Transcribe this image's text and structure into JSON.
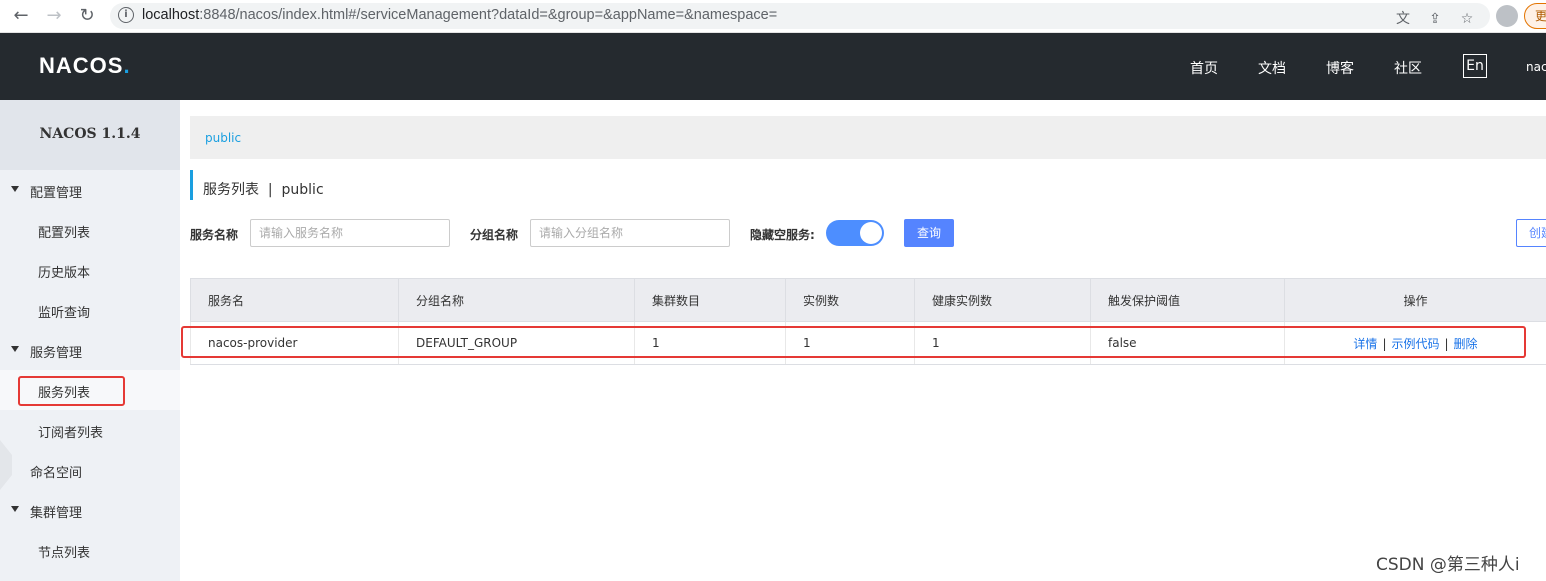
{
  "browser": {
    "url_host": "localhost",
    "url_path": ":8848/nacos/index.html#/serviceManagement?dataId=&group=&appName=&namespace=",
    "update_label": "更"
  },
  "header": {
    "logo_main": "NACOS",
    "logo_dot": ".",
    "nav": [
      "首页",
      "文档",
      "博客",
      "社区"
    ],
    "lang": "En",
    "user": "nac"
  },
  "sidebar": {
    "title": "NACOS 1.1.4",
    "items": [
      {
        "label": "配置管理",
        "type": "group"
      },
      {
        "label": "配置列表",
        "type": "sub"
      },
      {
        "label": "历史版本",
        "type": "sub"
      },
      {
        "label": "监听查询",
        "type": "sub"
      },
      {
        "label": "服务管理",
        "type": "group"
      },
      {
        "label": "服务列表",
        "type": "sub",
        "active": true
      },
      {
        "label": "订阅者列表",
        "type": "sub"
      },
      {
        "label": "命名空间",
        "type": "plain"
      },
      {
        "label": "集群管理",
        "type": "group"
      },
      {
        "label": "节点列表",
        "type": "sub"
      }
    ]
  },
  "main": {
    "breadcrumb": "public",
    "page_title": "服务列表  |  public",
    "filters": {
      "service_name_label": "服务名称",
      "service_name_placeholder": "请输入服务名称",
      "group_name_label": "分组名称",
      "group_name_placeholder": "请输入分组名称",
      "hide_empty_label": "隐藏空服务:",
      "hide_empty_on": true,
      "query_label": "查询",
      "create_label": "创建服务"
    },
    "table": {
      "columns": [
        "服务名",
        "分组名称",
        "集群数目",
        "实例数",
        "健康实例数",
        "触发保护阈值",
        "操作"
      ],
      "rows": [
        [
          "nacos-provider",
          "DEFAULT_GROUP",
          "1",
          "1",
          "1",
          "false"
        ]
      ],
      "actions": [
        "详情",
        "示例代码",
        "删除"
      ]
    }
  },
  "watermark": "CSDN @第三种人i"
}
